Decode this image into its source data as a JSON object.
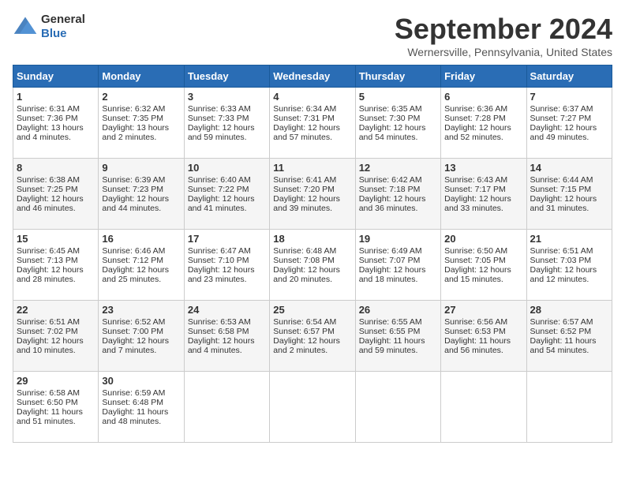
{
  "header": {
    "logo_general": "General",
    "logo_blue": "Blue",
    "month_title": "September 2024",
    "location": "Wernersville, Pennsylvania, United States"
  },
  "days_of_week": [
    "Sunday",
    "Monday",
    "Tuesday",
    "Wednesday",
    "Thursday",
    "Friday",
    "Saturday"
  ],
  "weeks": [
    [
      {
        "day": "1",
        "lines": [
          "Sunrise: 6:31 AM",
          "Sunset: 7:36 PM",
          "Daylight: 13 hours",
          "and 4 minutes."
        ]
      },
      {
        "day": "2",
        "lines": [
          "Sunrise: 6:32 AM",
          "Sunset: 7:35 PM",
          "Daylight: 13 hours",
          "and 2 minutes."
        ]
      },
      {
        "day": "3",
        "lines": [
          "Sunrise: 6:33 AM",
          "Sunset: 7:33 PM",
          "Daylight: 12 hours",
          "and 59 minutes."
        ]
      },
      {
        "day": "4",
        "lines": [
          "Sunrise: 6:34 AM",
          "Sunset: 7:31 PM",
          "Daylight: 12 hours",
          "and 57 minutes."
        ]
      },
      {
        "day": "5",
        "lines": [
          "Sunrise: 6:35 AM",
          "Sunset: 7:30 PM",
          "Daylight: 12 hours",
          "and 54 minutes."
        ]
      },
      {
        "day": "6",
        "lines": [
          "Sunrise: 6:36 AM",
          "Sunset: 7:28 PM",
          "Daylight: 12 hours",
          "and 52 minutes."
        ]
      },
      {
        "day": "7",
        "lines": [
          "Sunrise: 6:37 AM",
          "Sunset: 7:27 PM",
          "Daylight: 12 hours",
          "and 49 minutes."
        ]
      }
    ],
    [
      {
        "day": "8",
        "lines": [
          "Sunrise: 6:38 AM",
          "Sunset: 7:25 PM",
          "Daylight: 12 hours",
          "and 46 minutes."
        ]
      },
      {
        "day": "9",
        "lines": [
          "Sunrise: 6:39 AM",
          "Sunset: 7:23 PM",
          "Daylight: 12 hours",
          "and 44 minutes."
        ]
      },
      {
        "day": "10",
        "lines": [
          "Sunrise: 6:40 AM",
          "Sunset: 7:22 PM",
          "Daylight: 12 hours",
          "and 41 minutes."
        ]
      },
      {
        "day": "11",
        "lines": [
          "Sunrise: 6:41 AM",
          "Sunset: 7:20 PM",
          "Daylight: 12 hours",
          "and 39 minutes."
        ]
      },
      {
        "day": "12",
        "lines": [
          "Sunrise: 6:42 AM",
          "Sunset: 7:18 PM",
          "Daylight: 12 hours",
          "and 36 minutes."
        ]
      },
      {
        "day": "13",
        "lines": [
          "Sunrise: 6:43 AM",
          "Sunset: 7:17 PM",
          "Daylight: 12 hours",
          "and 33 minutes."
        ]
      },
      {
        "day": "14",
        "lines": [
          "Sunrise: 6:44 AM",
          "Sunset: 7:15 PM",
          "Daylight: 12 hours",
          "and 31 minutes."
        ]
      }
    ],
    [
      {
        "day": "15",
        "lines": [
          "Sunrise: 6:45 AM",
          "Sunset: 7:13 PM",
          "Daylight: 12 hours",
          "and 28 minutes."
        ]
      },
      {
        "day": "16",
        "lines": [
          "Sunrise: 6:46 AM",
          "Sunset: 7:12 PM",
          "Daylight: 12 hours",
          "and 25 minutes."
        ]
      },
      {
        "day": "17",
        "lines": [
          "Sunrise: 6:47 AM",
          "Sunset: 7:10 PM",
          "Daylight: 12 hours",
          "and 23 minutes."
        ]
      },
      {
        "day": "18",
        "lines": [
          "Sunrise: 6:48 AM",
          "Sunset: 7:08 PM",
          "Daylight: 12 hours",
          "and 20 minutes."
        ]
      },
      {
        "day": "19",
        "lines": [
          "Sunrise: 6:49 AM",
          "Sunset: 7:07 PM",
          "Daylight: 12 hours",
          "and 18 minutes."
        ]
      },
      {
        "day": "20",
        "lines": [
          "Sunrise: 6:50 AM",
          "Sunset: 7:05 PM",
          "Daylight: 12 hours",
          "and 15 minutes."
        ]
      },
      {
        "day": "21",
        "lines": [
          "Sunrise: 6:51 AM",
          "Sunset: 7:03 PM",
          "Daylight: 12 hours",
          "and 12 minutes."
        ]
      }
    ],
    [
      {
        "day": "22",
        "lines": [
          "Sunrise: 6:51 AM",
          "Sunset: 7:02 PM",
          "Daylight: 12 hours",
          "and 10 minutes."
        ]
      },
      {
        "day": "23",
        "lines": [
          "Sunrise: 6:52 AM",
          "Sunset: 7:00 PM",
          "Daylight: 12 hours",
          "and 7 minutes."
        ]
      },
      {
        "day": "24",
        "lines": [
          "Sunrise: 6:53 AM",
          "Sunset: 6:58 PM",
          "Daylight: 12 hours",
          "and 4 minutes."
        ]
      },
      {
        "day": "25",
        "lines": [
          "Sunrise: 6:54 AM",
          "Sunset: 6:57 PM",
          "Daylight: 12 hours",
          "and 2 minutes."
        ]
      },
      {
        "day": "26",
        "lines": [
          "Sunrise: 6:55 AM",
          "Sunset: 6:55 PM",
          "Daylight: 11 hours",
          "and 59 minutes."
        ]
      },
      {
        "day": "27",
        "lines": [
          "Sunrise: 6:56 AM",
          "Sunset: 6:53 PM",
          "Daylight: 11 hours",
          "and 56 minutes."
        ]
      },
      {
        "day": "28",
        "lines": [
          "Sunrise: 6:57 AM",
          "Sunset: 6:52 PM",
          "Daylight: 11 hours",
          "and 54 minutes."
        ]
      }
    ],
    [
      {
        "day": "29",
        "lines": [
          "Sunrise: 6:58 AM",
          "Sunset: 6:50 PM",
          "Daylight: 11 hours",
          "and 51 minutes."
        ]
      },
      {
        "day": "30",
        "lines": [
          "Sunrise: 6:59 AM",
          "Sunset: 6:48 PM",
          "Daylight: 11 hours",
          "and 48 minutes."
        ]
      },
      {
        "day": "",
        "lines": []
      },
      {
        "day": "",
        "lines": []
      },
      {
        "day": "",
        "lines": []
      },
      {
        "day": "",
        "lines": []
      },
      {
        "day": "",
        "lines": []
      }
    ]
  ]
}
